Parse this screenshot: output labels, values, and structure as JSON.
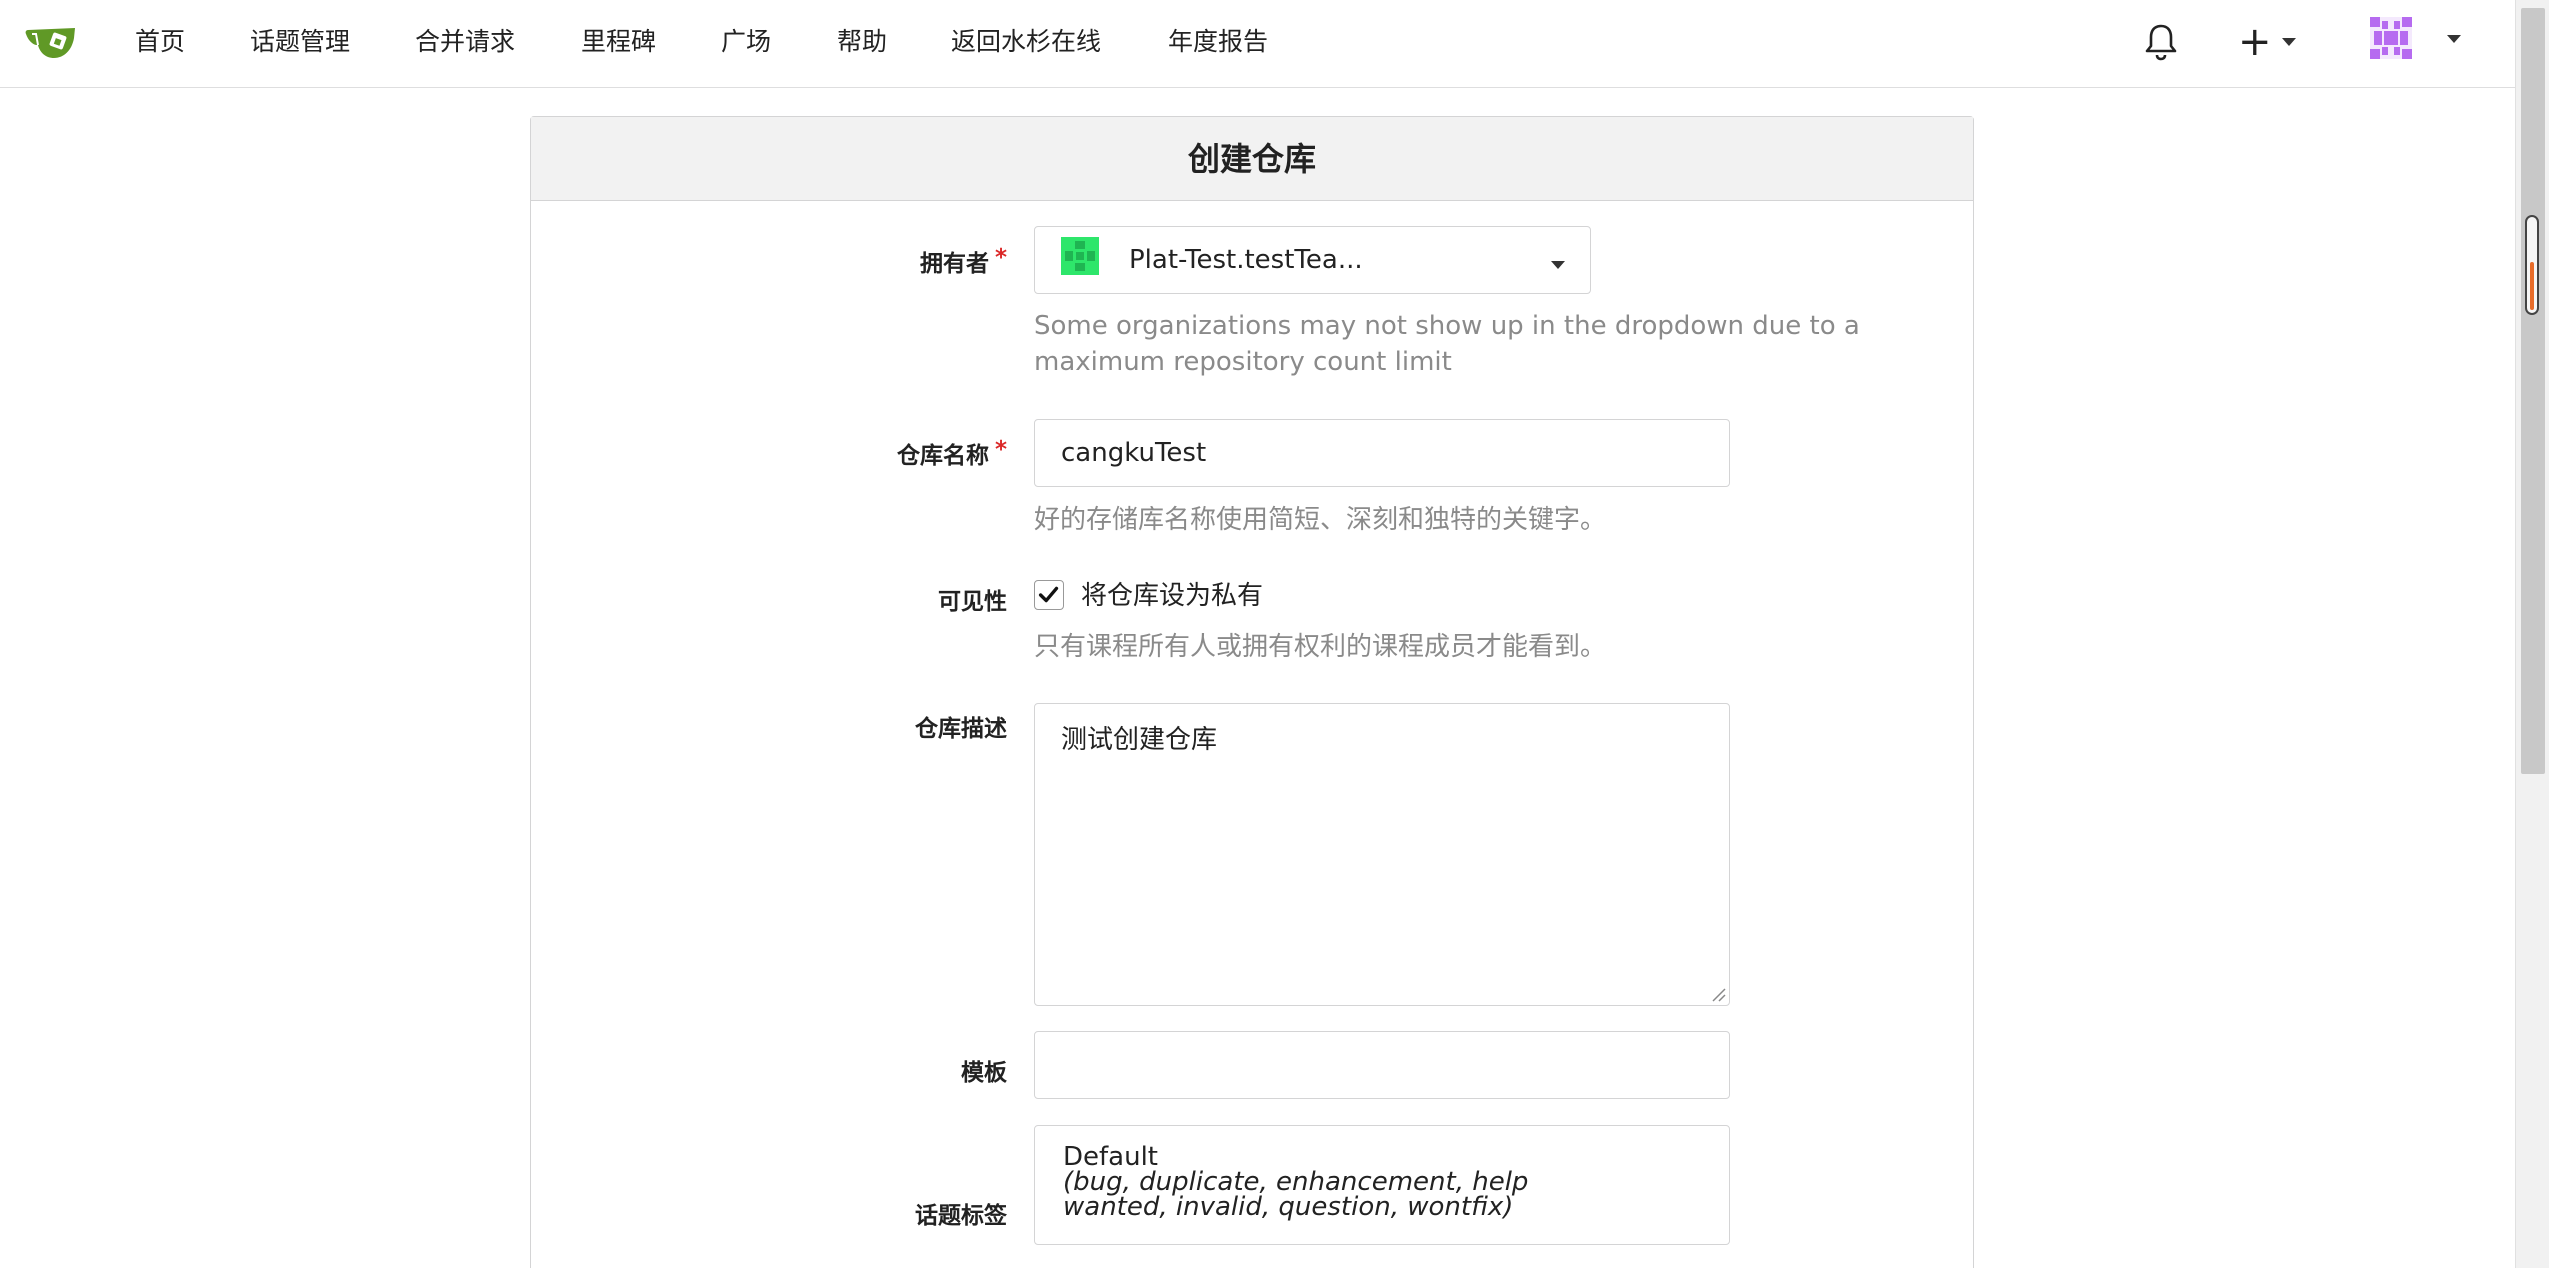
{
  "nav": {
    "items": [
      "首页",
      "话题管理",
      "合并请求",
      "里程碑",
      "广场",
      "帮助",
      "返回水杉在线",
      "年度报告"
    ]
  },
  "icons": {
    "logo": "tea-cup-logo-icon",
    "notifications": "bell-icon",
    "create": "plus-icon",
    "user": "avatar"
  },
  "colors": {
    "logo_green": "#609926",
    "owner_avatar": "#2ee66b",
    "user_avatar": "#b66bf0",
    "required": "#db2828",
    "scroll_mark": "#e86c2a"
  },
  "card": {
    "title": "创建仓库"
  },
  "form": {
    "owner": {
      "label": "拥有者",
      "required": "*",
      "value": "Plat-Test.testTea...",
      "help": "Some organizations may not show up in the dropdown due to a maximum repository count limit"
    },
    "repo_name": {
      "label": "仓库名称",
      "required": "*",
      "value": "cangkuTest",
      "help": "好的存储库名称使用简短、深刻和独特的关键字。"
    },
    "visibility": {
      "label": "可见性",
      "checkbox_label": "将仓库设为私有",
      "checked": true,
      "help": "只有课程所有人或拥有权利的课程成员才能看到。"
    },
    "description": {
      "label": "仓库描述",
      "value": "测试创建仓库"
    },
    "template": {
      "label": "模板",
      "value": ""
    },
    "issue_labels": {
      "label": "话题标签",
      "value": "Default",
      "detail": "(bug, duplicate, enhancement, help wanted, invalid, question, wontfix)"
    }
  }
}
